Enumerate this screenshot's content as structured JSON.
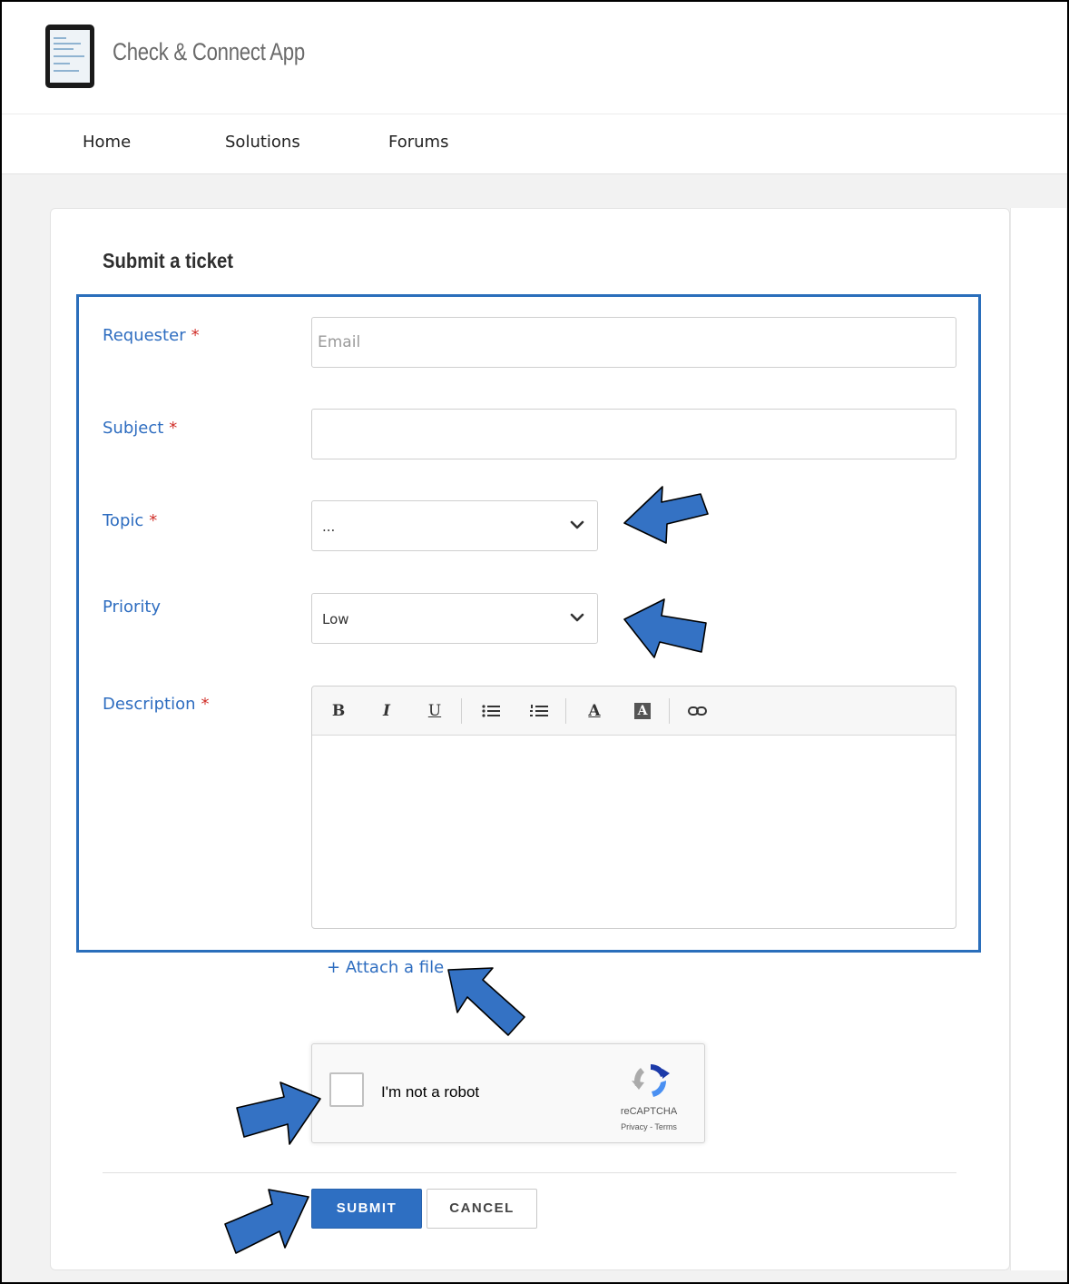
{
  "header": {
    "app_title": "Check & Connect App"
  },
  "nav": {
    "items": [
      "Home",
      "Solutions",
      "Forums"
    ]
  },
  "form": {
    "title": "Submit a ticket",
    "requester": {
      "label": "Requester",
      "required_mark": "*",
      "placeholder": "Email",
      "value": ""
    },
    "subject": {
      "label": "Subject",
      "required_mark": "*",
      "value": ""
    },
    "topic": {
      "label": "Topic",
      "required_mark": "*",
      "selected": "..."
    },
    "priority": {
      "label": "Priority",
      "selected": "Low"
    },
    "description": {
      "label": "Description",
      "required_mark": "*",
      "toolbar": {
        "bold": "B",
        "italic": "I",
        "underline": "U",
        "text_color": "A",
        "bg_color": "A"
      }
    },
    "attach_label": "+ Attach a file",
    "captcha": {
      "label": "I'm not a robot",
      "brand": "reCAPTCHA",
      "links": "Privacy - Terms"
    },
    "submit_label": "SUBMIT",
    "cancel_label": "CANCEL"
  },
  "colors": {
    "accent": "#2e6dc0",
    "required": "#d0302a",
    "annotation_arrow": "#3472c4",
    "highlight_border": "#2a6ebb"
  }
}
